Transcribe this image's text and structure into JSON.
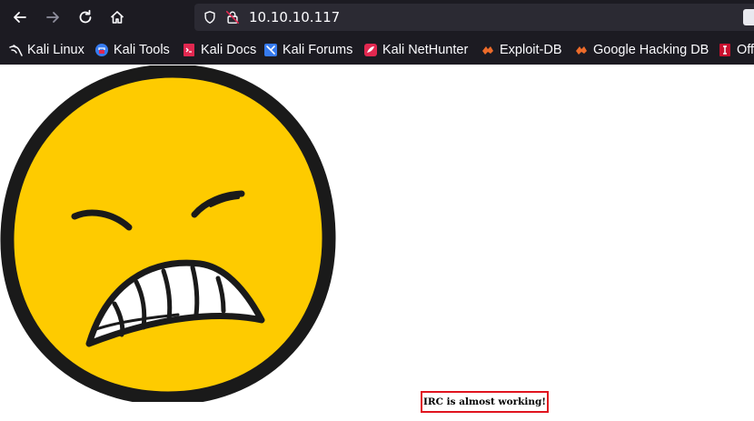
{
  "browser": {
    "url": "10.10.10.117",
    "nav": {
      "back_icon": "arrow-left-icon",
      "forward_icon": "arrow-right-icon",
      "reload_icon": "reload-icon",
      "home_icon": "home-icon"
    },
    "chrome_color": "#1c1b22",
    "urlbar_color": "#2b2a33"
  },
  "bookmarks": [
    {
      "label": "Kali Linux",
      "icon": "kali-dragon-icon"
    },
    {
      "label": "Kali Tools",
      "icon": "kali-tools-icon"
    },
    {
      "label": "Kali Docs",
      "icon": "kali-docs-icon"
    },
    {
      "label": "Kali Forums",
      "icon": "kali-forums-icon"
    },
    {
      "label": "Kali NetHunter",
      "icon": "nethunter-icon"
    },
    {
      "label": "Exploit-DB",
      "icon": "exploit-db-icon"
    },
    {
      "label": "Google Hacking DB",
      "icon": "ghdb-icon"
    },
    {
      "label": "Off",
      "icon": "offsec-icon"
    }
  ],
  "page": {
    "image": "angry-emoji-face",
    "caption": "IRC is almost working!",
    "caption_border_color": "#e0141f",
    "face_color": "#fecb00"
  }
}
